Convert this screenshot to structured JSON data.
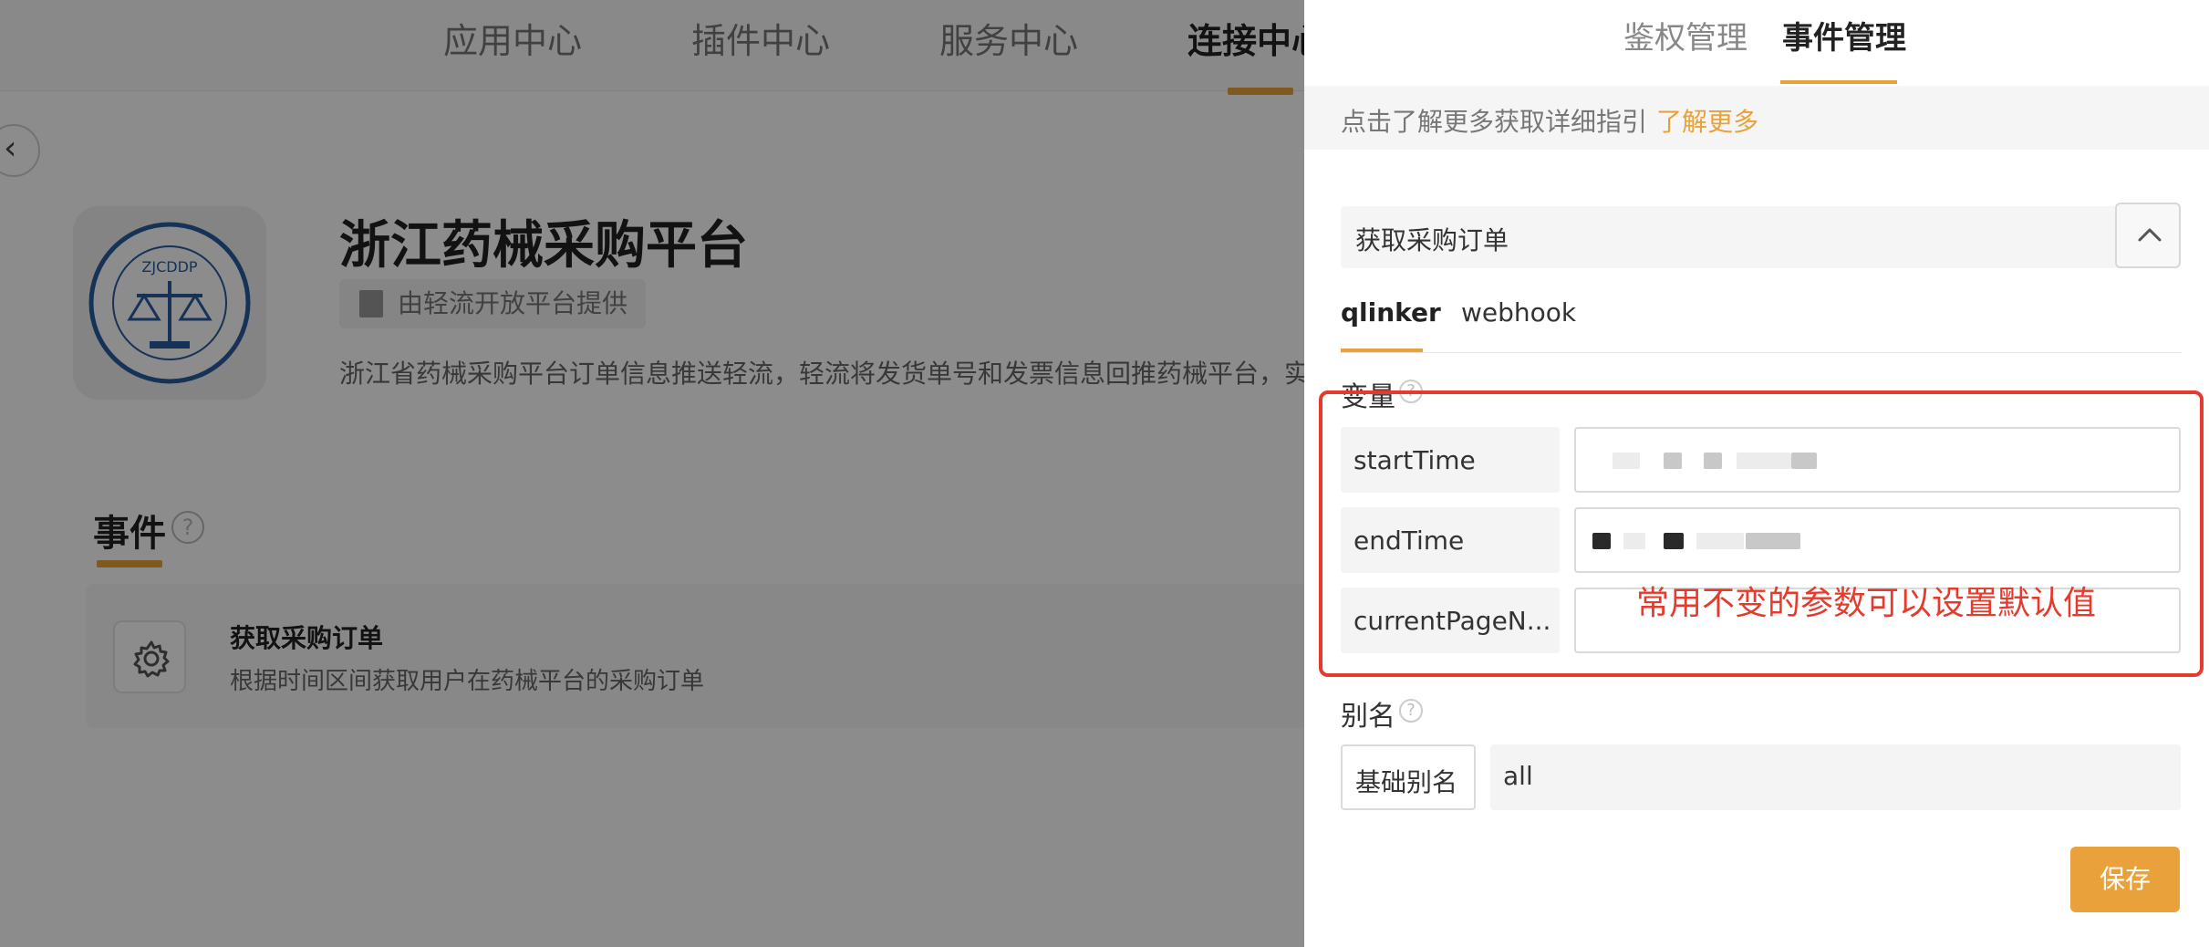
{
  "background": {
    "nav_tabs": [
      "应用中心",
      "插件中心",
      "服务中心",
      "连接中心"
    ],
    "active_nav_tab": "连接中心",
    "app": {
      "title": "浙江药械采购平台",
      "provider": "由轻流开放平台提供",
      "description": "浙江省药械采购平台订单信息推送轻流，轻流将发货单号和发票信息回推药械平台，实",
      "logo_text": "ZJCDDP"
    },
    "events_section": {
      "title": "事件",
      "event": {
        "title": "获取采购订单",
        "description": "根据时间区间获取用户在药械平台的采购订单"
      }
    }
  },
  "drawer": {
    "tabs": [
      "鉴权管理",
      "事件管理"
    ],
    "active_tab": "事件管理",
    "info": {
      "text": "点击了解更多获取详细指引",
      "link": "了解更多"
    },
    "selected_event": "获取采购订单",
    "sub_tabs": [
      "qlinker",
      "webhook"
    ],
    "active_sub_tab": "qlinker",
    "variables_label": "变量",
    "variables": [
      {
        "key": "startTime"
      },
      {
        "key": "endTime"
      },
      {
        "key": "currentPageN..."
      }
    ],
    "annotation": "常用不变的参数可以设置默认值",
    "alias_label": "别名",
    "alias": {
      "key": "基础别名",
      "value": "all"
    },
    "save_label": "保存"
  },
  "colors": {
    "accent": "#e9a23b",
    "annotation": "#e53a2c"
  }
}
